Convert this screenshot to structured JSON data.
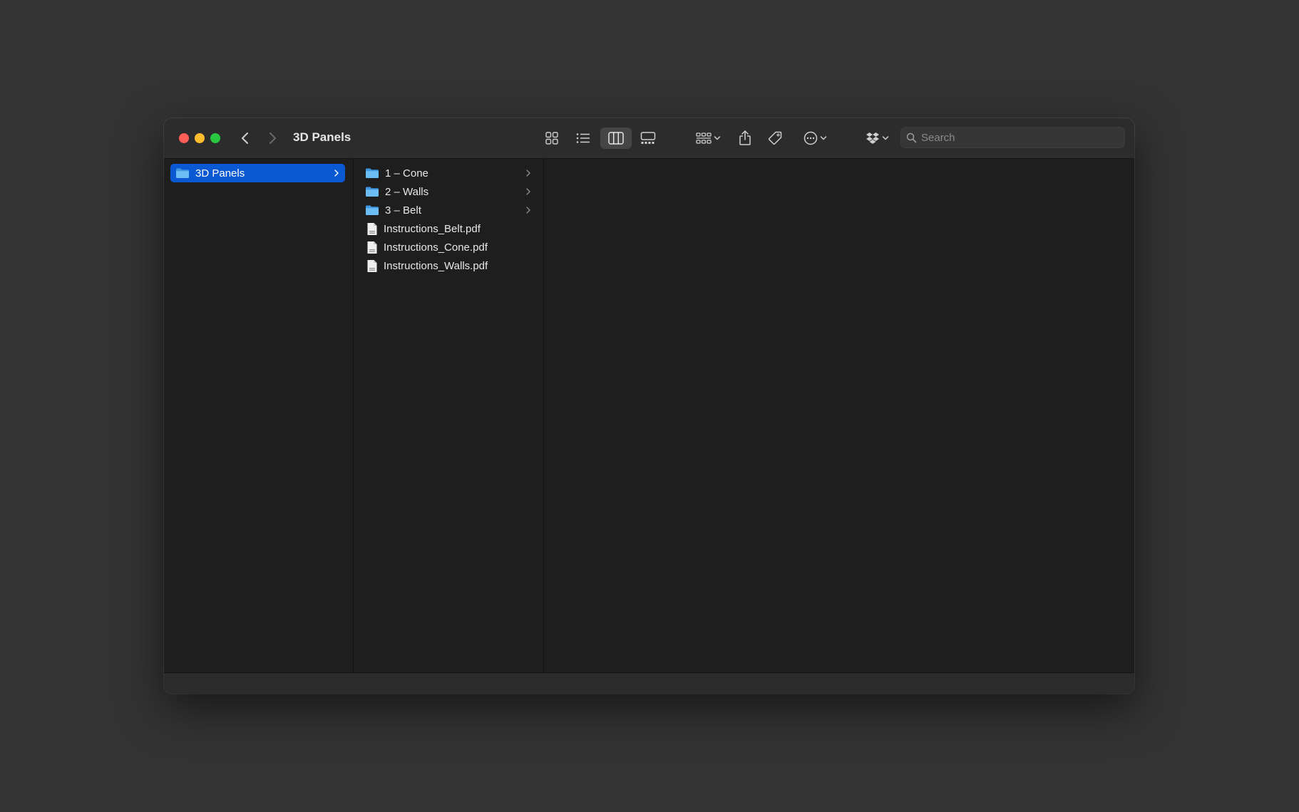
{
  "window": {
    "title": "3D Panels"
  },
  "toolbar": {
    "nav_back_icon": "chevron-left-icon",
    "nav_forward_icon": "chevron-right-icon",
    "view_icons": [
      "icon-view-icon",
      "list-view-icon",
      "column-view-icon",
      "gallery-view-icon"
    ],
    "active_view": "column-view-icon",
    "group_icon": "group-by-icon",
    "share_icon": "share-icon",
    "tag_icon": "tag-icon",
    "more_icon": "more-actions-icon",
    "dropbox_icon": "dropbox-icon"
  },
  "search": {
    "placeholder": "Search",
    "value": ""
  },
  "columns": [
    {
      "items": [
        {
          "name": "3D Panels",
          "kind": "folder",
          "has_children": true,
          "selected": true
        }
      ]
    },
    {
      "items": [
        {
          "name": "1 – Cone",
          "kind": "folder",
          "has_children": true
        },
        {
          "name": "2 – Walls",
          "kind": "folder",
          "has_children": true
        },
        {
          "name": "3 – Belt",
          "kind": "folder",
          "has_children": true
        },
        {
          "name": "Instructions_Belt.pdf",
          "kind": "pdf",
          "has_children": false
        },
        {
          "name": "Instructions_Cone.pdf",
          "kind": "pdf",
          "has_children": false
        },
        {
          "name": "Instructions_Walls.pdf",
          "kind": "pdf",
          "has_children": false
        }
      ]
    }
  ],
  "colors": {
    "desktop": "#333333",
    "window_bg": "#1e1e1e",
    "titlebar": "#2c2c2c",
    "selection": "#0a59d2",
    "folder_blue": "#4aa6ea",
    "close": "#ff5f57",
    "minimize": "#febc2e",
    "zoom": "#28c840"
  }
}
